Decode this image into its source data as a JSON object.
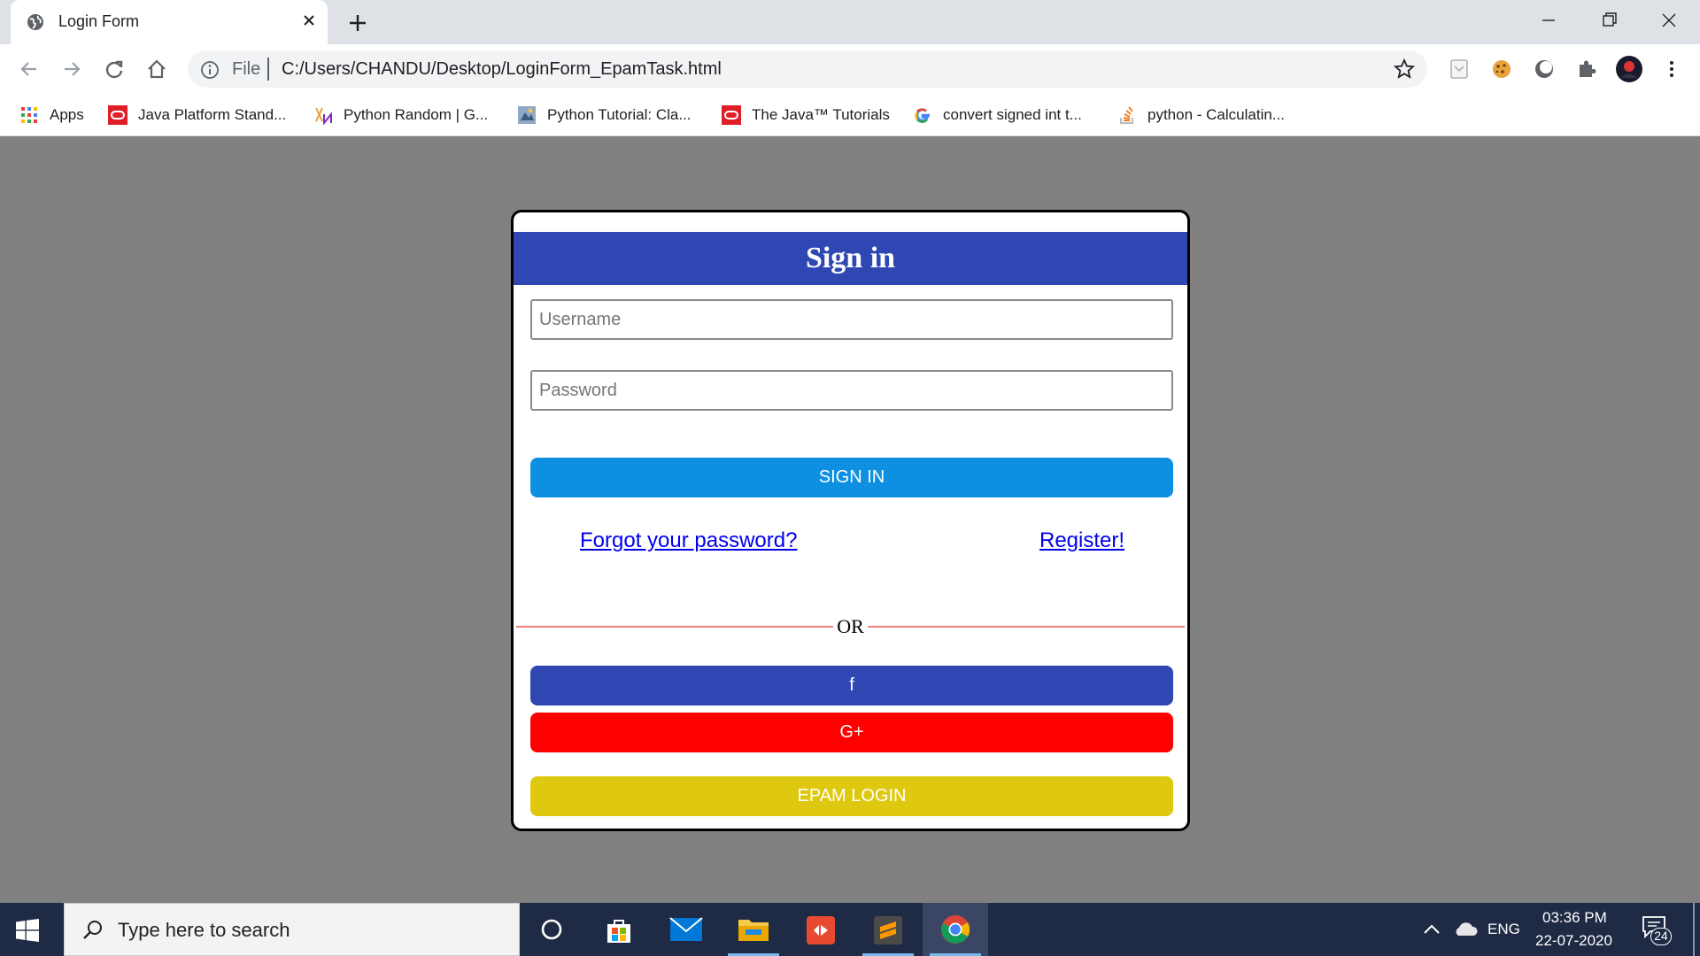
{
  "browser": {
    "tab": {
      "title": "Login Form"
    },
    "omnibox": {
      "scheme_label": "File",
      "url": "C:/Users/CHANDU/Desktop/LoginForm_EpamTask.html"
    },
    "bookmarks": [
      {
        "label": "Apps",
        "icon": "apps-grid-icon"
      },
      {
        "label": "Java Platform Stand...",
        "icon": "oracle-icon"
      },
      {
        "label": "Python Random | G...",
        "icon": "geeksforgeeks-icon"
      },
      {
        "label": "Python Tutorial: Cla...",
        "icon": "python-course-icon"
      },
      {
        "label": "The Java™ Tutorials",
        "icon": "oracle-icon"
      },
      {
        "label": "convert signed int t...",
        "icon": "google-icon"
      },
      {
        "label": "python - Calculatin...",
        "icon": "stackoverflow-icon"
      }
    ]
  },
  "login": {
    "title": "Sign in",
    "username_placeholder": "Username",
    "password_placeholder": "Password",
    "signin_label": "SIGN IN",
    "forgot_label": "Forgot your password?",
    "register_label": "Register!",
    "or_label": "OR",
    "facebook_label": "f",
    "google_label": "G+",
    "epam_label": "EPAM LOGIN"
  },
  "colors": {
    "header_blue": "#2e47b3",
    "signin_blue": "#0d8fe2",
    "facebook_blue": "#2e47b3",
    "google_red": "#ff0000",
    "epam_yellow": "#dfc810",
    "or_line": "#f08080",
    "page_bg": "#808080"
  },
  "taskbar": {
    "search_placeholder": "Type here to search",
    "language": "ENG",
    "time": "03:36 PM",
    "date": "22-07-2020",
    "notification_count": "24"
  }
}
